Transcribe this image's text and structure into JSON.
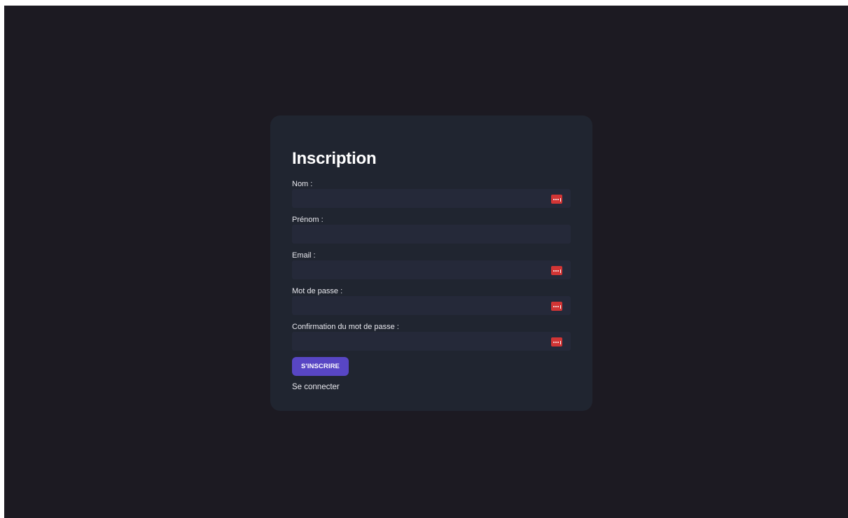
{
  "form": {
    "title": "Inscription",
    "fields": [
      {
        "label": "Nom :",
        "value": "",
        "has_password_icon": true
      },
      {
        "label": "Prénom :",
        "value": "",
        "has_password_icon": false
      },
      {
        "label": "Email :",
        "value": "",
        "has_password_icon": true
      },
      {
        "label": "Mot de passe :",
        "value": "",
        "has_password_icon": true
      },
      {
        "label": "Confirmation du mot de passe :",
        "value": "",
        "has_password_icon": true
      }
    ],
    "submit_label": "S'INSCRIRE",
    "login_link": "Se connecter"
  },
  "icons": {
    "password_manager": "password-manager-icon"
  },
  "colors": {
    "page_background": "#1c1a22",
    "card_background": "#202530",
    "input_background": "#252939",
    "button_accent": "#5846c4",
    "password_icon": "#d23535",
    "text": "#ffffff"
  }
}
